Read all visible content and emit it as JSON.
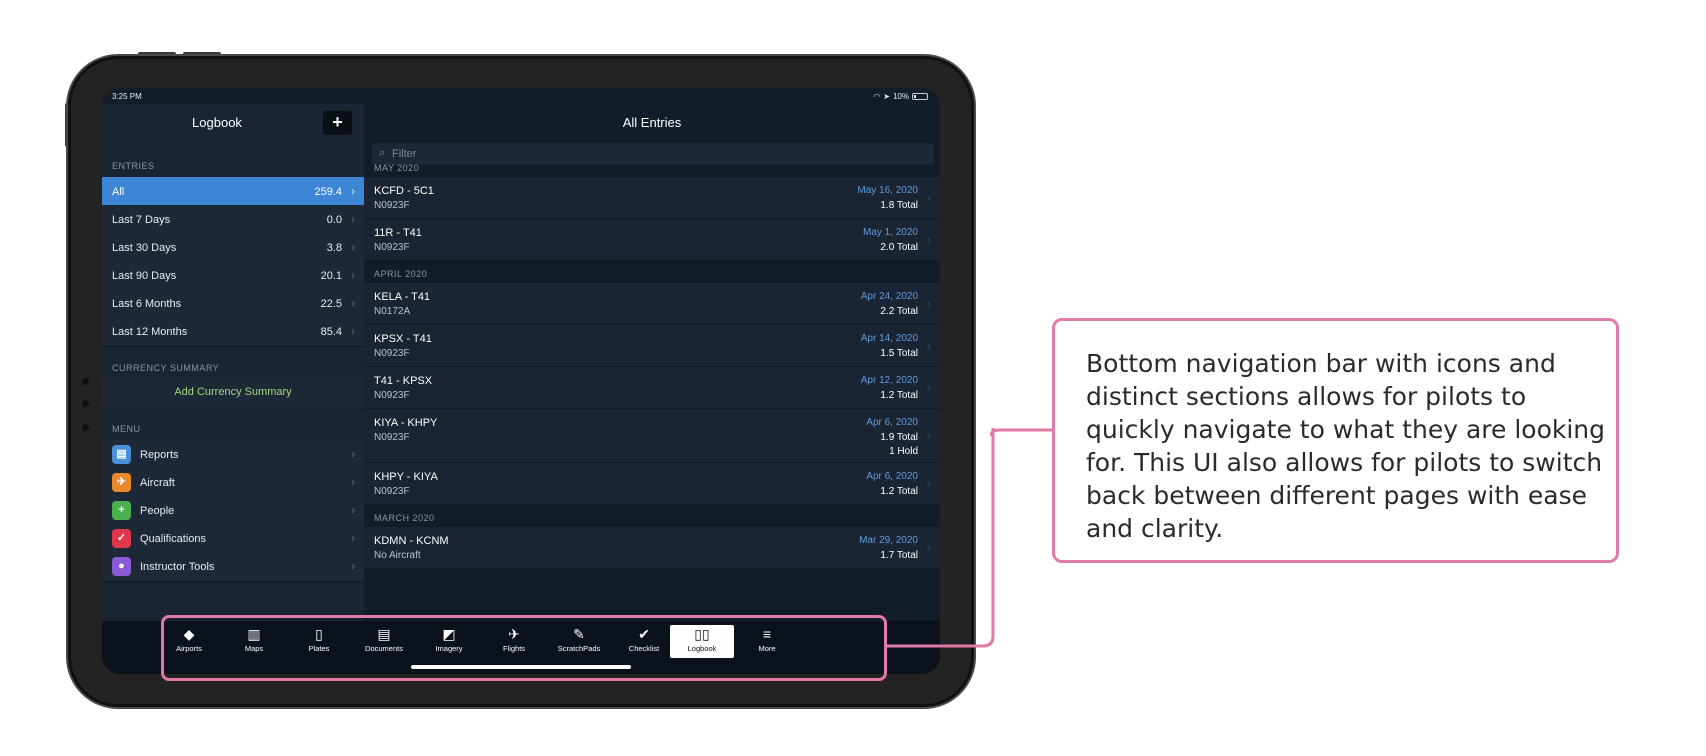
{
  "status": {
    "time": "3:25 PM",
    "battery": "10%"
  },
  "sidebar": {
    "title": "Logbook",
    "add_label": "+",
    "entries_label": "ENTRIES",
    "entries": [
      {
        "label": "All",
        "value": "259.4",
        "active": true
      },
      {
        "label": "Last 7 Days",
        "value": "0.0"
      },
      {
        "label": "Last 30 Days",
        "value": "3.8"
      },
      {
        "label": "Last 90 Days",
        "value": "20.1"
      },
      {
        "label": "Last 6 Months",
        "value": "22.5"
      },
      {
        "label": "Last 12 Months",
        "value": "85.4"
      }
    ],
    "currency_label": "CURRENCY SUMMARY",
    "add_currency": "Add Currency Summary",
    "menu_label": "MENU",
    "menu": [
      {
        "label": "Reports",
        "icon": "reports-icon",
        "color": "#4a90d9"
      },
      {
        "label": "Aircraft",
        "icon": "airplane-icon",
        "color": "#e8892b"
      },
      {
        "label": "People",
        "icon": "person-add-icon",
        "color": "#4caf50"
      },
      {
        "label": "Qualifications",
        "icon": "check-badge-icon",
        "color": "#e0364a"
      },
      {
        "label": "Instructor Tools",
        "icon": "instructor-icon",
        "color": "#8a5ad6"
      }
    ]
  },
  "main": {
    "title": "All Entries",
    "filter_placeholder": "Filter",
    "months": [
      {
        "label": "MAY 2020"
      },
      {
        "label": "APRIL 2020"
      },
      {
        "label": "MARCH 2020"
      }
    ],
    "flights": [
      {
        "route": "KCFD - 5C1",
        "tail": "N0923F",
        "date": "May 16, 2020",
        "total": "1.8 Total"
      },
      {
        "route": "11R - T41",
        "tail": "N0923F",
        "date": "May 1, 2020",
        "total": "2.0 Total"
      },
      {
        "route": "KELA - T41",
        "tail": "N0172A",
        "date": "Apr 24, 2020",
        "total": "2.2 Total"
      },
      {
        "route": "KPSX - T41",
        "tail": "N0923F",
        "date": "Apr 14, 2020",
        "total": "1.5 Total"
      },
      {
        "route": "T41 - KPSX",
        "tail": "N0923F",
        "date": "Apr 12, 2020",
        "total": "1.2 Total"
      },
      {
        "route": "KIYA - KHPY",
        "tail": "N0923F",
        "date": "Apr 6, 2020",
        "total": "1.9 Total",
        "hold": "1 Hold"
      },
      {
        "route": "KHPY - KIYA",
        "tail": "N0923F",
        "date": "Apr 6, 2020",
        "total": "1.2 Total"
      },
      {
        "route": "KDMN - KCNM",
        "tail": "No Aircraft",
        "date": "Mar 29, 2020",
        "total": "1.7 Total"
      }
    ]
  },
  "tabs": [
    {
      "label": "Airports",
      "icon": "airport-diamond-icon",
      "glyph": "◆"
    },
    {
      "label": "Maps",
      "icon": "map-icon",
      "glyph": "▥"
    },
    {
      "label": "Plates",
      "icon": "plates-icon",
      "glyph": "▯"
    },
    {
      "label": "Documents",
      "icon": "documents-icon",
      "glyph": "▤"
    },
    {
      "label": "Imagery",
      "icon": "imagery-icon",
      "glyph": "◩"
    },
    {
      "label": "Flights",
      "icon": "flights-icon",
      "glyph": "✈"
    },
    {
      "label": "ScratchPads",
      "icon": "pencil-icon",
      "glyph": "✎"
    },
    {
      "label": "Checklist",
      "icon": "checkmark-icon",
      "glyph": "✔"
    },
    {
      "label": "Logbook",
      "icon": "logbook-icon",
      "glyph": "▯▯",
      "active": true
    },
    {
      "label": "More",
      "icon": "menu-icon",
      "glyph": "≡"
    }
  ],
  "callout": {
    "text": "Bottom navigation bar with icons and distinct sections allows for pilots to quickly navigate to what they are looking for. This UI also allows for pilots to switch back between different pages with ease and clarity.",
    "border_color": "#e07aa6"
  }
}
